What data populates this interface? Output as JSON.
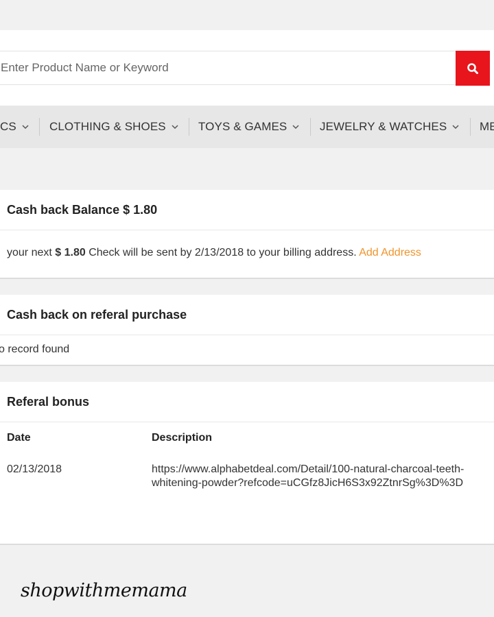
{
  "search": {
    "placeholder": "Enter Product Name or Keyword",
    "button_icon": "search-icon"
  },
  "nav": {
    "items": [
      {
        "label": "CS"
      },
      {
        "label": "CLOTHING & SHOES"
      },
      {
        "label": "TOYS & GAMES"
      },
      {
        "label": "JEWELRY & WATCHES"
      },
      {
        "label": "ME"
      }
    ]
  },
  "balance": {
    "title": "Cash back Balance $ 1.80",
    "text_prefix": "your next ",
    "amount": "$ 1.80",
    "text_suffix": " Check will be sent by 2/13/2018 to your billing address. ",
    "link": "Add Address"
  },
  "referral_purchase": {
    "title": "Cash back on referal purchase",
    "empty": "o record found"
  },
  "referral_bonus": {
    "title": "Referal bonus",
    "columns": [
      "Date",
      "Description"
    ],
    "rows": [
      {
        "date": "02/13/2018",
        "description": "https://www.alphabetdeal.com/Detail/100-natural-charcoal-teeth-whitening-powder?refcode=uCGfz8JicH6S3x92ZtnrSg%3D%3D"
      }
    ]
  },
  "watermark": "shopwithmemama",
  "colors": {
    "accent": "#e8151d",
    "link": "#f0942c",
    "nav_bg": "#e7e7e7",
    "page_bg": "#f1f1f1"
  }
}
